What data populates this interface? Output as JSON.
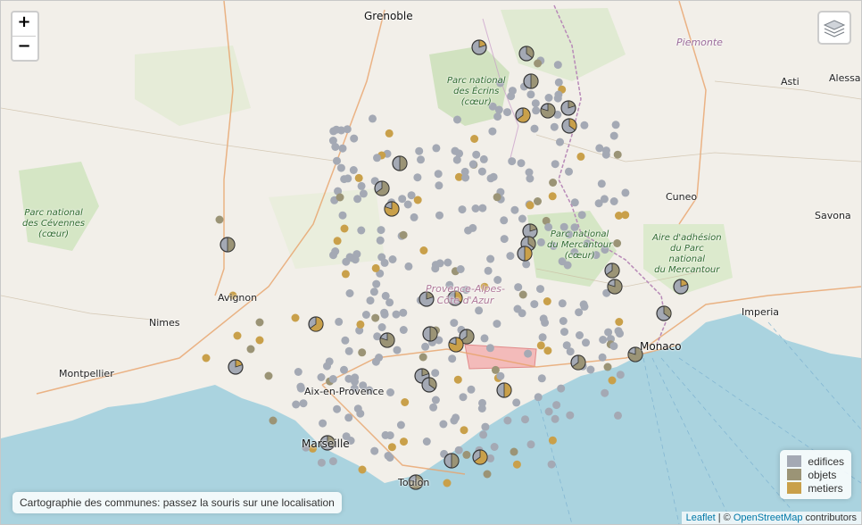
{
  "map": {
    "zoom_in": "+",
    "zoom_out": "−",
    "layers_icon": "layers-icon",
    "info_text": "Cartographie des communes: passez la souris sur une localisation",
    "attribution": {
      "leaflet": "Leaflet",
      "sep": " | © ",
      "osm": "OpenStreetMap",
      "suffix": " contributors"
    },
    "legend": [
      {
        "label": "edifices",
        "color": "#a4a9b4"
      },
      {
        "label": "objets",
        "color": "#9b9476"
      },
      {
        "label": "metiers",
        "color": "#c9a04a"
      }
    ],
    "places": {
      "grenoble": "Grenoble",
      "piemonte": "Piemonte",
      "asti": "Asti",
      "alessan": "Alessan",
      "cuneo": "Cuneo",
      "savona": "Savona",
      "imperia": "Imperia",
      "monaco": "Monaco",
      "avignon": "Avignon",
      "nimes": "Nimes",
      "montpellier": "Montpellier",
      "aix": "Aix-en-Provence",
      "marseille": "Marseille",
      "toulon": "Toulon",
      "region": "Provence-Alpes-\nCôte d'Azur",
      "ecrins": "Parc national\ndes Écrins\n(cœur)",
      "cevennes": "Parc national\ndes Cévennes\n(cœur)",
      "mercantour": "Parc national\ndu Mercantour\n(cœur)",
      "aire": "Aire d'adhésion\ndu Parc\nnational\ndu Mercantour"
    },
    "colors": {
      "sea": "#aad3df",
      "land": "#f2efe9",
      "edifices": "#a4a9b4",
      "objets": "#9b9476",
      "metiers": "#c9a04a"
    }
  }
}
